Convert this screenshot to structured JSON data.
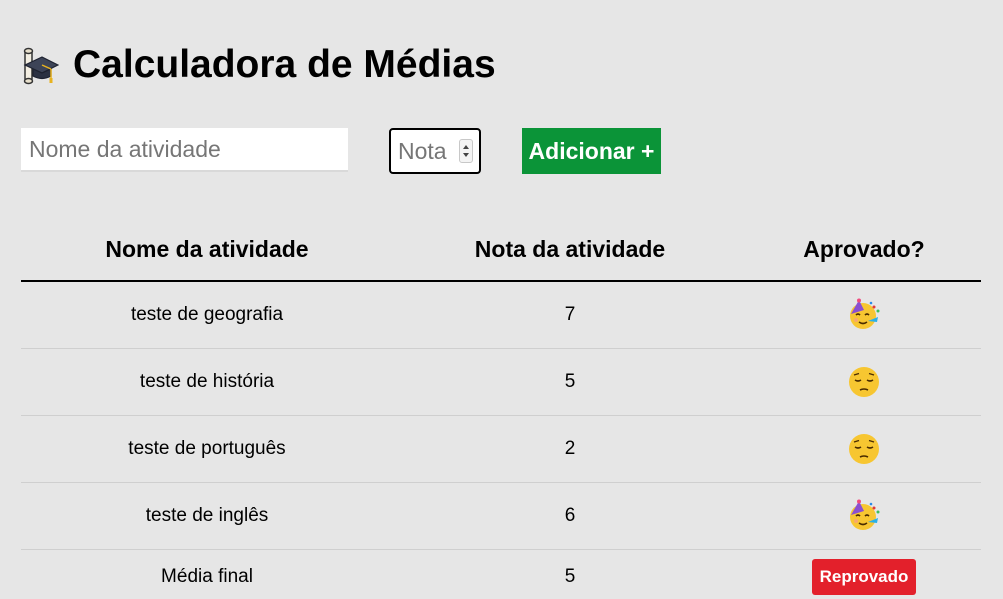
{
  "app": {
    "title": "Calculadora de Médias",
    "title_icon": "graduation-cap-icon"
  },
  "form": {
    "name_placeholder": "Nome da atividade",
    "name_value": "",
    "grade_placeholder": "Nota",
    "grade_value": "",
    "add_button_label": "Adicionar +",
    "add_button_color": "#0b9438"
  },
  "table": {
    "headers": [
      "Nome da atividade",
      "Nota da atividade",
      "Aprovado?"
    ],
    "rows": [
      {
        "name": "teste de geografia",
        "grade": "7",
        "approved_icon": "party-face-icon"
      },
      {
        "name": "teste de história",
        "grade": "5",
        "approved_icon": "pensive-face-icon"
      },
      {
        "name": "teste de português",
        "grade": "2",
        "approved_icon": "pensive-face-icon"
      },
      {
        "name": "teste de inglês",
        "grade": "6",
        "approved_icon": "party-face-icon"
      }
    ],
    "final": {
      "label": "Média final",
      "value": "5",
      "status": "Reprovado",
      "status_color": "#e3202b"
    }
  }
}
